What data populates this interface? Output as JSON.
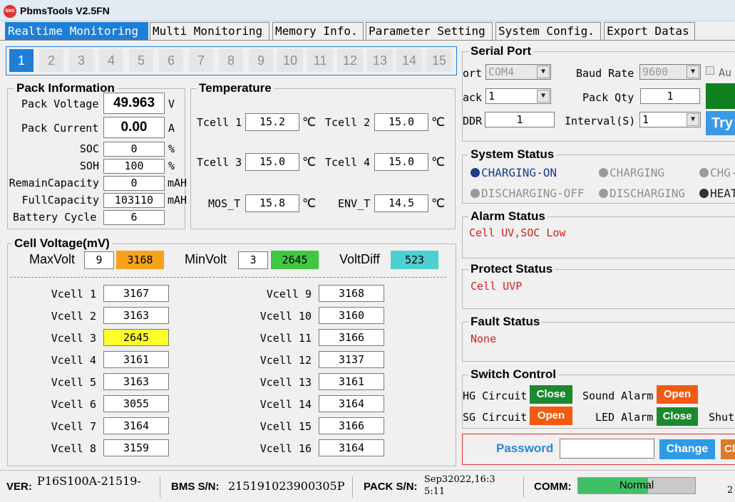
{
  "app": {
    "title": "PbmsTools V2.5FN",
    "logo_text": "BMS"
  },
  "tabs": [
    "Realtime Monitoring",
    "Multi Monitoring",
    "Memory Info.",
    "Parameter Setting",
    "System Config.",
    "Export Datas"
  ],
  "pages": [
    "1",
    "2",
    "3",
    "4",
    "5",
    "6",
    "7",
    "8",
    "9",
    "10",
    "11",
    "12",
    "13",
    "14",
    "15"
  ],
  "pack_info": {
    "title": "Pack Information",
    "pack_voltage_label": "Pack Voltage",
    "pack_voltage": "49.963",
    "pack_voltage_unit": "V",
    "pack_current_label": "Pack Current",
    "pack_current": "0.00",
    "pack_current_unit": "A",
    "soc_label": "SOC",
    "soc": "0",
    "soc_unit": "%",
    "soh_label": "SOH",
    "soh": "100",
    "soh_unit": "%",
    "remain_label": "RemainCapacity",
    "remain": "0",
    "remain_unit": "mAH",
    "full_label": "FullCapacity",
    "full": "103110",
    "full_unit": "mAH",
    "cycle_label": "Battery Cycle",
    "cycle": "6"
  },
  "temperature": {
    "title": "Temperature",
    "unit": "℃",
    "tcell1_label": "Tcell 1",
    "tcell1": "15.2",
    "tcell2_label": "Tcell 2",
    "tcell2": "15.0",
    "tcell3_label": "Tcell 3",
    "tcell3": "15.0",
    "tcell4_label": "Tcell 4",
    "tcell4": "15.0",
    "mos_label": "MOS_T",
    "mos": "15.8",
    "env_label": "ENV_T",
    "env": "14.5"
  },
  "cell_voltage": {
    "title": "Cell Voltage(mV)",
    "max_label": "MaxVolt",
    "max_cell": "9",
    "max_value": "3168",
    "min_label": "MinVolt",
    "min_cell": "3",
    "min_value": "2645",
    "diff_label": "VoltDiff",
    "diff_value": "523",
    "max_color": "#f7a21b",
    "min_color": "#41c741",
    "diff_color": "#4fd0d0",
    "low_cell_color": "#ffff2a",
    "cells": [
      {
        "label": "Vcell 1",
        "value": "3167"
      },
      {
        "label": "Vcell 2",
        "value": "3163"
      },
      {
        "label": "Vcell 3",
        "value": "2645"
      },
      {
        "label": "Vcell 4",
        "value": "3161"
      },
      {
        "label": "Vcell 5",
        "value": "3163"
      },
      {
        "label": "Vcell 6",
        "value": "3055"
      },
      {
        "label": "Vcell 7",
        "value": "3164"
      },
      {
        "label": "Vcell 8",
        "value": "3159"
      },
      {
        "label": "Vcell 9",
        "value": "3168"
      },
      {
        "label": "Vcell 10",
        "value": "3160"
      },
      {
        "label": "Vcell 11",
        "value": "3166"
      },
      {
        "label": "Vcell 12",
        "value": "3137"
      },
      {
        "label": "Vcell 13",
        "value": "3161"
      },
      {
        "label": "Vcell 14",
        "value": "3164"
      },
      {
        "label": "Vcell 15",
        "value": "3166"
      },
      {
        "label": "Vcell 16",
        "value": "3164"
      }
    ]
  },
  "serial": {
    "title": "Serial Port",
    "port_label": "ort",
    "port_value": "COM4",
    "baud_label": "Baud Rate",
    "baud_value": "9600",
    "auto_label": "Au",
    "pack_label": "ack",
    "pack_value": "1",
    "pack_qty_label": "Pack Qty",
    "pack_qty_value": "1",
    "addr_label": "DDR",
    "addr_value": "1",
    "interval_label": "Interval(S)",
    "interval_value": "1",
    "try_label": "Try"
  },
  "system_status": {
    "title": "System Status",
    "items": [
      "CHARGING-ON",
      "CHARGING",
      "CHG-",
      "DISCHARGING-OFF",
      "DISCHARGING",
      "HEAT"
    ],
    "active_color": "#1a3c8c",
    "inactive_color": "#9a9a9a",
    "dark_color": "#333333"
  },
  "alarm": {
    "title": "Alarm Status",
    "text": "Cell UV,SOC Low"
  },
  "protect": {
    "title": "Protect Status",
    "text": "Cell UVP"
  },
  "fault": {
    "title": "Fault Status",
    "text": "None"
  },
  "switch": {
    "title": "Switch Control",
    "chg_label": "HG Circuit",
    "chg_btn": "Close",
    "sound_label": "Sound Alarm",
    "sound_btn": "Open",
    "dsg_label": "SG Circuit",
    "dsg_btn": "Open",
    "led_label": "LED Alarm",
    "led_btn": "Close",
    "shut_label": "Shut"
  },
  "password": {
    "label": "Password",
    "value": "",
    "change_btn": "Change",
    "other_btn": "Cl"
  },
  "statusbar": {
    "ver_label": "VER:",
    "ver_value": "P16S100A-21519-",
    "bms_sn_label": "BMS S/N:",
    "bms_sn_value": "215191023900305P",
    "pack_sn_label": "PACK S/N:",
    "pack_sn_line1": "Sep32022,16:3",
    "pack_sn_line2": "5:11",
    "comm_label": "COMM:",
    "comm_value": "Normal",
    "comm_progress": 0.6,
    "extra": "2"
  }
}
